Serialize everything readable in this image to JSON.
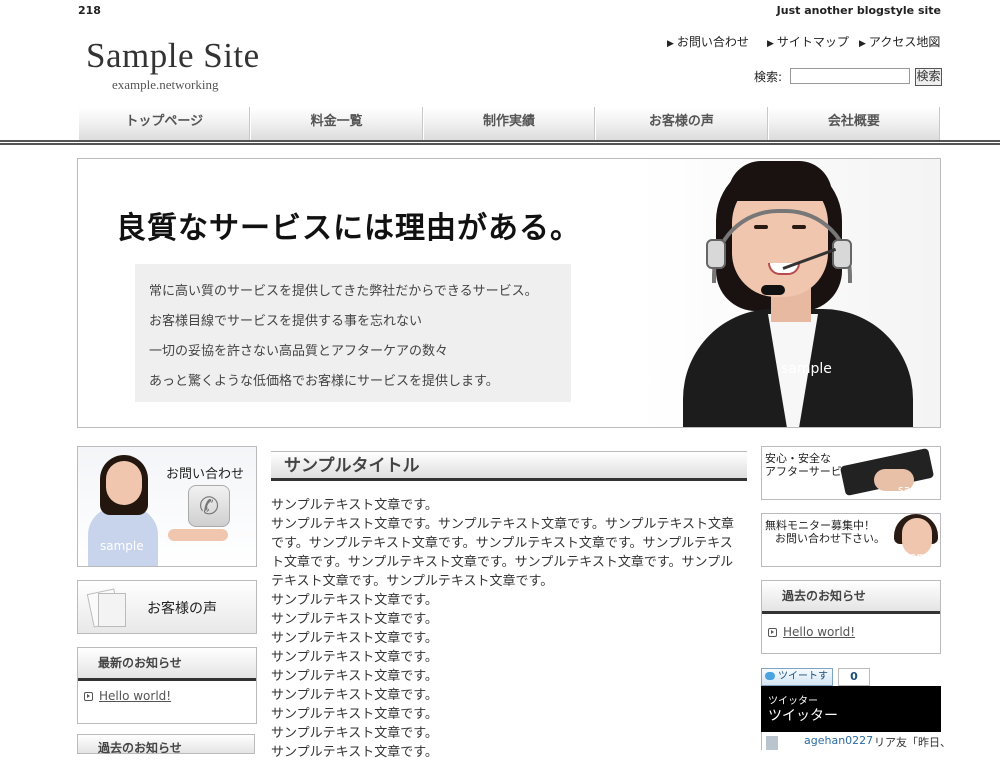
{
  "top": {
    "number": "218",
    "tagline": "Just another blogstyle site"
  },
  "logo": {
    "title": "Sample Site",
    "subtitle": "example.networking"
  },
  "util_links": [
    "お問い合わせ",
    "サイトマップ",
    "アクセス地図"
  ],
  "search": {
    "label": "検索:",
    "button": "検索",
    "value": ""
  },
  "nav": [
    "トップページ",
    "料金一覧",
    "制作実績",
    "お客様の声",
    "会社概要"
  ],
  "hero": {
    "headline": "良質なサービスには理由がある。",
    "lines": [
      "常に高い質のサービスを提供してきた弊社だからできるサービス。",
      "お客様目線でサービスを提供する事を忘れない",
      "一切の妥協を許さない高品質とアフターケアの数々",
      "あっと驚くような低価格でお客様にサービスを提供します。"
    ],
    "sample": "sample"
  },
  "left": {
    "contact": {
      "title": "お問い合わせ",
      "sample": "sample"
    },
    "voice": {
      "title": "お客様の声"
    },
    "recent": {
      "title": "最新のお知らせ",
      "link": "Hello world!"
    },
    "past": {
      "title": "過去のお知らせ"
    }
  },
  "main": {
    "title": "サンプルタイトル",
    "paragraphs": [
      "サンプルテキスト文章です。",
      "サンプルテキスト文章です。サンプルテキスト文章です。サンプルテキスト文章です。サンプルテキスト文章です。サンプルテキスト文章です。サンプルテキスト文章です。サンプルテキスト文章です。サンプルテキスト文章です。サンプルテキスト文章です。サンプルテキスト文章です。",
      "サンプルテキスト文章です。",
      "サンプルテキスト文章です。",
      "サンプルテキスト文章です。",
      "サンプルテキスト文章です。",
      "サンプルテキスト文章です。",
      "サンプルテキスト文章です。",
      "サンプルテキスト文章です。",
      "サンプルテキスト文章です。",
      "サンプルテキスト文章です。"
    ]
  },
  "right": {
    "banner1": {
      "line1": "安心・安全な",
      "line2": "アフターサービス",
      "sample": "sample"
    },
    "banner2": {
      "line1": "無料モニター募集中！",
      "line2": "お問い合わせ下さい。",
      "sample": "sample"
    },
    "past": {
      "title": "過去のお知らせ",
      "link": "Hello world!"
    },
    "tweet": {
      "button": "ツイートする",
      "count": "0"
    },
    "twitter": {
      "small": "ツイッター",
      "big": "ツイッター",
      "user": "agehan0227",
      "text": "リア友「昨日、"
    }
  },
  "colors": {
    "accent_line": "#333333",
    "tweet_text": "#1c4f79"
  }
}
